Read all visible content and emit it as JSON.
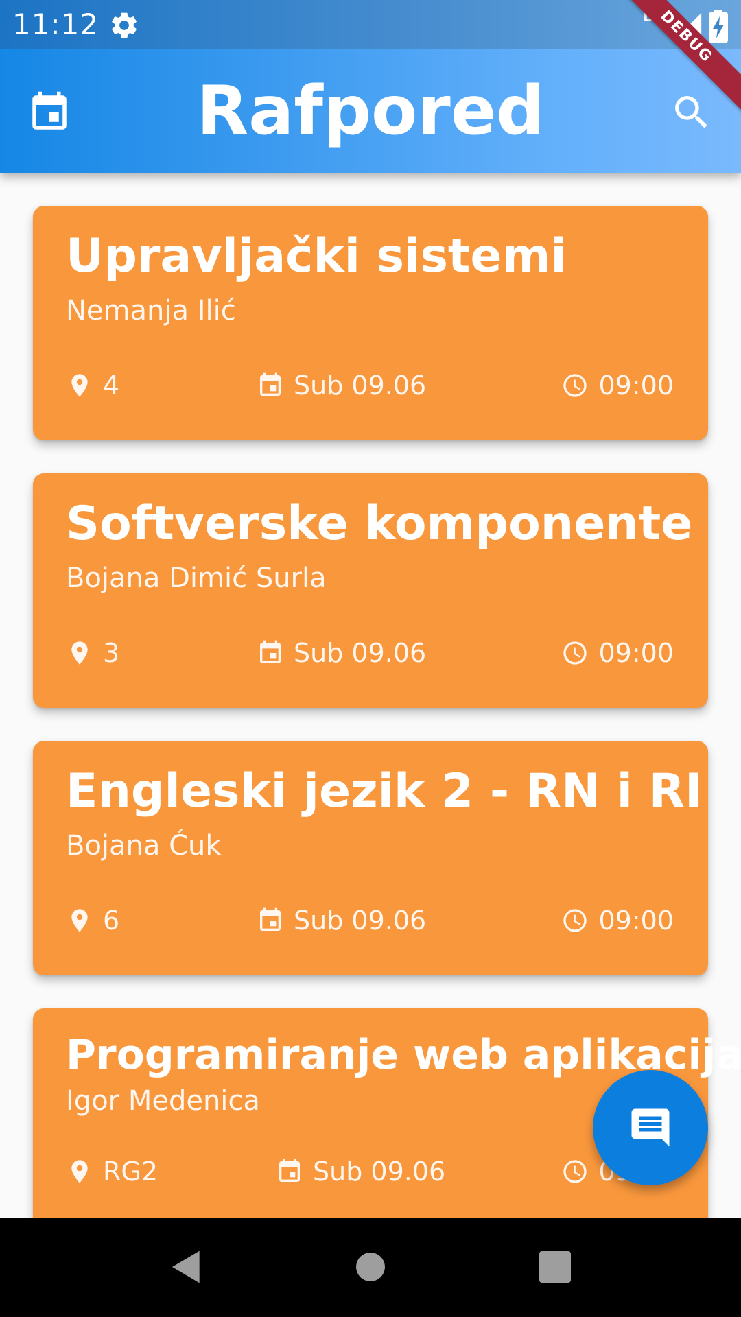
{
  "status_bar": {
    "time": "11:12",
    "network_label": "LTE",
    "icons": [
      "gear-icon",
      "signal-icon",
      "battery-charging-icon"
    ]
  },
  "debug_banner": {
    "label": "DEBUG"
  },
  "app_bar": {
    "title": "Rafpored",
    "left_icon": "calendar-icon",
    "right_icon": "search-icon"
  },
  "colors": {
    "app_bar_gradient_start": "#1587e5",
    "app_bar_gradient_end": "#7ab9fc",
    "card_background": "#f9973d",
    "fab_background": "#0c7fde",
    "text_on_accent": "#ffffff"
  },
  "lectures": [
    {
      "title": "Upravljački sistemi",
      "lecturer": "Nemanja Ilić",
      "room": "4",
      "date": "Sub 09.06",
      "time": "09:00"
    },
    {
      "title": "Softverske komponente",
      "lecturer": "Bojana Dimić Surla",
      "room": "3",
      "date": "Sub 09.06",
      "time": "09:00"
    },
    {
      "title": "Engleski jezik 2 - RN i RI",
      "lecturer": "Bojana Ćuk",
      "room": "6",
      "date": "Sub 09.06",
      "time": "09:00"
    },
    {
      "title": "Programiranje web aplikacija",
      "lecturer": "Igor Medenica",
      "room": "RG2",
      "date": "Sub 09.06",
      "time": "09:00"
    }
  ],
  "fab": {
    "icon": "message-icon"
  },
  "nav_bar": {
    "icons": [
      "back-icon",
      "home-icon",
      "recents-icon"
    ]
  }
}
